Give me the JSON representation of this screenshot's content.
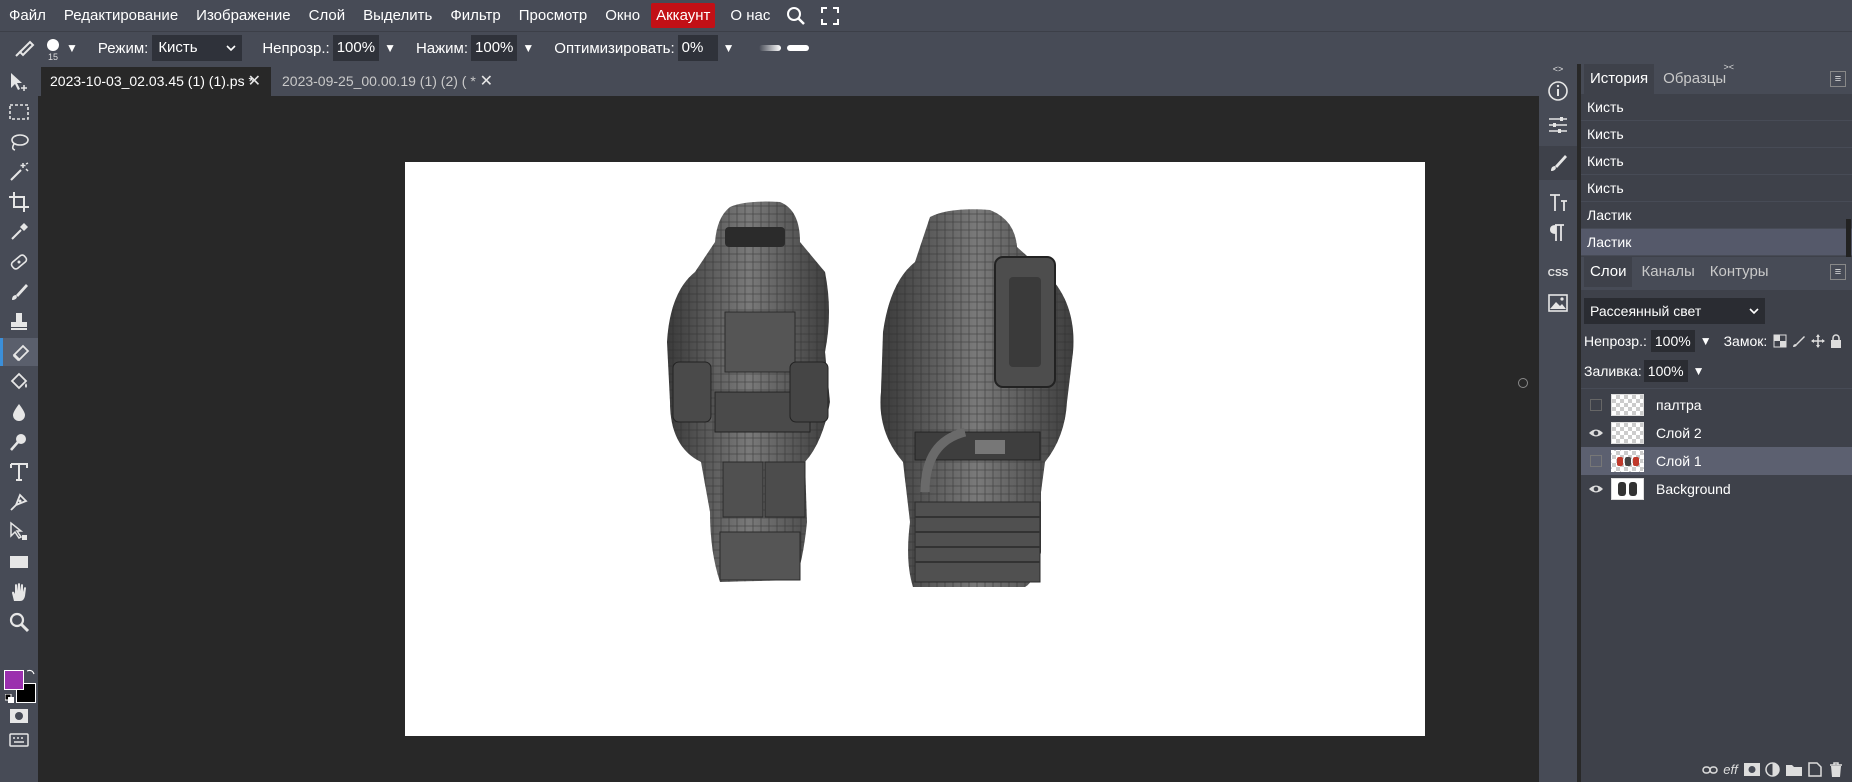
{
  "menubar": {
    "items": [
      "Файл",
      "Редактирование",
      "Изображение",
      "Слой",
      "Выделить",
      "Фильтр",
      "Просмотр",
      "Окно"
    ],
    "account": "Аккаунт",
    "about": "О нас",
    "accent_color": "#c21016"
  },
  "options": {
    "brush_size": "15",
    "mode_label": "Режим:",
    "mode_value": "Кисть",
    "opacity_label": "Непрозр.:",
    "opacity_value": "100%",
    "pressure_label": "Нажим:",
    "pressure_value": "100%",
    "optimize_label": "Оптимизировать:",
    "optimize_value": "0%"
  },
  "tabs": [
    {
      "title": "2023-10-03_02.03.45 (1) (1).ps",
      "modified": "*",
      "close": "✕"
    },
    {
      "title": "2023-09-25_00.00.19 (1) (2) (",
      "modified": "*",
      "close": "✕"
    }
  ],
  "history": {
    "tabs": [
      "История",
      "Образцы"
    ],
    "items": [
      "Кисть",
      "Кисть",
      "Кисть",
      "Кисть",
      "Ластик",
      "Ластик"
    ]
  },
  "layers": {
    "tabs": [
      "Слои",
      "Каналы",
      "Контуры"
    ],
    "blend_mode": "Рассеянный свет",
    "opacity_label": "Непрозр.:",
    "opacity_value": "100%",
    "lock_label": "Замок:",
    "fill_label": "Заливка:",
    "fill_value": "100%",
    "items": [
      {
        "name": "палтра",
        "visible": false,
        "selected": false
      },
      {
        "name": "Слой 2",
        "visible": true,
        "selected": false
      },
      {
        "name": "Слой 1",
        "visible": false,
        "selected": true
      },
      {
        "name": "Background",
        "visible": true,
        "selected": false
      }
    ],
    "bottom_icons": [
      "link-icon",
      "effects-icon",
      "mask-icon",
      "adjustment-icon",
      "folder-icon",
      "new-layer-icon",
      "delete-icon"
    ]
  },
  "colors": {
    "foreground": "#9b2fae",
    "background": "#000000",
    "active_tool_accent": "#3b8fd9"
  }
}
